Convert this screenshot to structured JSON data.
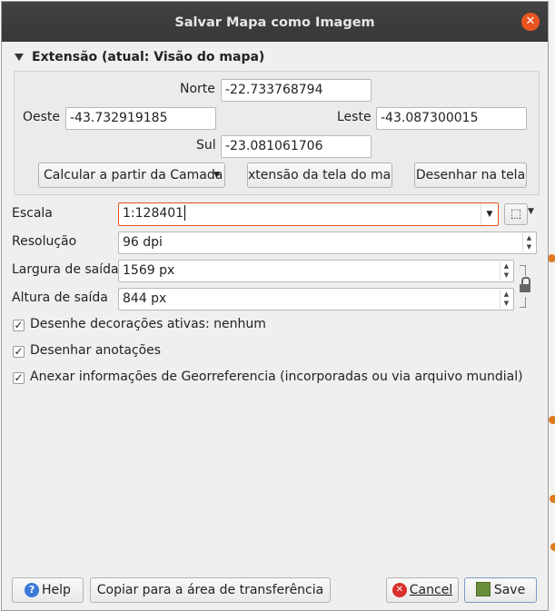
{
  "window": {
    "title": "Salvar Mapa como Imagem"
  },
  "extent": {
    "header": "Extensão (atual: Visão do mapa)",
    "north_label": "Norte",
    "north_value": "-22.733768794",
    "west_label": "Oeste",
    "west_value": "-43.732919185",
    "east_label": "Leste",
    "east_value": "-43.087300015",
    "south_label": "Sul",
    "south_value": "-23.081061706",
    "calc_layer_label": "Calcular a partir da Camada",
    "map_canvas_label": "xtensão da tela do map",
    "draw_canvas_label": "Desenhar na tela"
  },
  "settings": {
    "scale_label": "Escala",
    "scale_value": "1:128401",
    "resolution_label": "Resolução",
    "resolution_value": "96 dpi",
    "width_label": "Largura de saída",
    "width_value": "1569 px",
    "height_label": "Altura de saída",
    "height_value": "844 px"
  },
  "options": {
    "decorations_label": "Desenhe decorações ativas: nenhum",
    "annotations_label": "Desenhar anotações",
    "georef_label": "Anexar informações de Georreferencia (incorporadas ou via arquivo mundial)"
  },
  "buttons": {
    "help_label": "Help",
    "copy_label": "Copiar para a área de transferência",
    "cancel_label": "Cancel",
    "save_label": "Save"
  },
  "icons": {
    "close": "close-icon",
    "collapse": "triangle-down-icon",
    "select": "select-cursor-icon",
    "lock": "lock-icon",
    "help": "help-icon",
    "cancel": "cancel-icon",
    "save": "save-icon"
  },
  "colors": {
    "close_button": "#e95420",
    "help_icon": "#3c78d8",
    "cancel_icon": "#d9302c",
    "titlebar": "#3b3b3b"
  }
}
